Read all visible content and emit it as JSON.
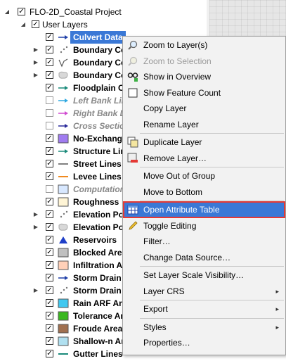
{
  "tree": {
    "root_label": "FLO-2D_Coastal Project",
    "group_label": "User Layers",
    "layers": [
      {
        "label": "Culvert Data",
        "checked": true,
        "style": "selected",
        "icon": "arrow-line-icon",
        "color": "#1f3fa8",
        "expandable": false
      },
      {
        "label": "Boundary Co",
        "checked": true,
        "style": "bold",
        "icon": "points-icon",
        "color": "#777777",
        "expandable": true
      },
      {
        "label": "Boundary Co",
        "checked": true,
        "style": "bold",
        "icon": "line-icon",
        "color": "#555555",
        "expandable": true
      },
      {
        "label": "Boundary Co",
        "checked": true,
        "style": "bold",
        "icon": "polygon-icon",
        "color": "#aaaaaa",
        "expandable": true
      },
      {
        "label": "Floodplain Cr",
        "checked": true,
        "style": "bold",
        "icon": "arrow-line-icon",
        "color": "#1a8a7a",
        "expandable": false
      },
      {
        "label": "Left Bank Lin",
        "checked": false,
        "style": "italic",
        "icon": "arrow-line-icon",
        "color": "#2fa8e0",
        "expandable": false
      },
      {
        "label": "Right Bank Li",
        "checked": false,
        "style": "italic",
        "icon": "arrow-line-icon",
        "color": "#d04ad0",
        "expandable": false
      },
      {
        "label": "Cross Section",
        "checked": false,
        "style": "italic",
        "icon": "arrow-line-icon",
        "color": "#2a2a9a",
        "expandable": false
      },
      {
        "label": "No-Exchang",
        "checked": true,
        "style": "bold",
        "icon": "fill-icon",
        "color": "#a07cf0",
        "expandable": false
      },
      {
        "label": "Structure Lin",
        "checked": true,
        "style": "bold",
        "icon": "arrow-line-icon",
        "color": "#1a8a7a",
        "expandable": false
      },
      {
        "label": "Street Lines",
        "checked": true,
        "style": "bold",
        "icon": "plain-line-icon",
        "color": "#808080",
        "expandable": false
      },
      {
        "label": "Levee Lines",
        "checked": true,
        "style": "bold",
        "icon": "plain-line-icon",
        "color": "#f08a20",
        "expandable": false
      },
      {
        "label": "Computation",
        "checked": false,
        "style": "italic",
        "icon": "fill-icon",
        "color": "#d8e8ff",
        "expandable": false
      },
      {
        "label": "Roughness",
        "checked": true,
        "style": "bold",
        "icon": "fill-icon",
        "color": "#fff5d6",
        "expandable": false
      },
      {
        "label": "Elevation Po",
        "checked": true,
        "style": "bold",
        "icon": "points-icon",
        "color": "#777777",
        "expandable": true
      },
      {
        "label": "Elevation Po",
        "checked": true,
        "style": "bold",
        "icon": "polygon-icon",
        "color": "#aaaaaa",
        "expandable": true
      },
      {
        "label": "Reservoirs",
        "checked": true,
        "style": "bold",
        "icon": "triangle-icon",
        "color": "#1f3fc8",
        "expandable": false
      },
      {
        "label": "Blocked Area",
        "checked": true,
        "style": "bold",
        "icon": "fill-icon",
        "color": "#c0c0c0",
        "expandable": false
      },
      {
        "label": "Infiltration A",
        "checked": true,
        "style": "bold",
        "icon": "fill-icon",
        "color": "#ffd0b8",
        "expandable": false
      },
      {
        "label": "Storm Drain",
        "checked": true,
        "style": "bold",
        "icon": "arrow-line-icon",
        "color": "#1f3fa8",
        "expandable": false
      },
      {
        "label": "Storm Drain",
        "checked": true,
        "style": "bold",
        "icon": "points-icon",
        "color": "#777777",
        "expandable": true
      },
      {
        "label": "Rain ARF Are",
        "checked": true,
        "style": "bold",
        "icon": "fill-icon",
        "color": "#40c8f0",
        "expandable": false
      },
      {
        "label": "Tolerance Ar",
        "checked": true,
        "style": "bold",
        "icon": "fill-icon",
        "color": "#3ab820",
        "expandable": false
      },
      {
        "label": "Froude Areas",
        "checked": true,
        "style": "bold",
        "icon": "fill-icon",
        "color": "#a07050",
        "expandable": false
      },
      {
        "label": "Shallow-n Ar",
        "checked": true,
        "style": "bold",
        "icon": "fill-icon",
        "color": "#b0e0f0",
        "expandable": false
      },
      {
        "label": "Gutter Lines",
        "checked": true,
        "style": "bold",
        "icon": "plain-line-icon",
        "color": "#1a8a7a",
        "expandable": false
      }
    ]
  },
  "menu": {
    "items": [
      {
        "label": "Zoom to Layer(s)",
        "icon": "zoom-icon",
        "disabled": false,
        "submenu": false
      },
      {
        "label": "Zoom to Selection",
        "icon": "zoom-selection-icon",
        "disabled": true,
        "submenu": false
      },
      {
        "label": "Show in Overview",
        "icon": "overview-icon",
        "disabled": false,
        "submenu": false
      },
      {
        "label": "Show Feature Count",
        "icon": "checkbox-icon",
        "disabled": false,
        "submenu": false
      },
      {
        "label": "Copy Layer",
        "icon": "",
        "disabled": false,
        "submenu": false
      },
      {
        "label": "Rename Layer",
        "icon": "",
        "disabled": false,
        "submenu": false
      },
      {
        "sep": true
      },
      {
        "label": "Duplicate Layer",
        "icon": "duplicate-icon",
        "disabled": false,
        "submenu": false
      },
      {
        "label": "Remove Layer…",
        "icon": "remove-layer-icon",
        "disabled": false,
        "submenu": false
      },
      {
        "sep": true
      },
      {
        "label": "Move Out of Group",
        "icon": "",
        "disabled": false,
        "submenu": false
      },
      {
        "label": "Move to Bottom",
        "icon": "",
        "disabled": false,
        "submenu": false
      },
      {
        "sep": true
      },
      {
        "label": "Open Attribute Table",
        "icon": "table-icon",
        "disabled": false,
        "submenu": false,
        "highlight": true
      },
      {
        "label": "Toggle Editing",
        "icon": "pencil-icon",
        "disabled": false,
        "submenu": false
      },
      {
        "label": "Filter…",
        "icon": "",
        "disabled": false,
        "submenu": false
      },
      {
        "label": "Change Data Source…",
        "icon": "",
        "disabled": false,
        "submenu": false
      },
      {
        "sep": true
      },
      {
        "label": "Set Layer Scale Visibility…",
        "icon": "",
        "disabled": false,
        "submenu": false
      },
      {
        "label": "Layer CRS",
        "icon": "",
        "disabled": false,
        "submenu": true
      },
      {
        "sep": true
      },
      {
        "label": "Export",
        "icon": "",
        "disabled": false,
        "submenu": true
      },
      {
        "sep": true
      },
      {
        "label": "Styles",
        "icon": "",
        "disabled": false,
        "submenu": true
      },
      {
        "label": "Properties…",
        "icon": "",
        "disabled": false,
        "submenu": false
      }
    ],
    "submenu_glyph": "▸",
    "check_glyph": "✓",
    "expand_glyph": "▶",
    "expanded_glyph": "◢"
  }
}
